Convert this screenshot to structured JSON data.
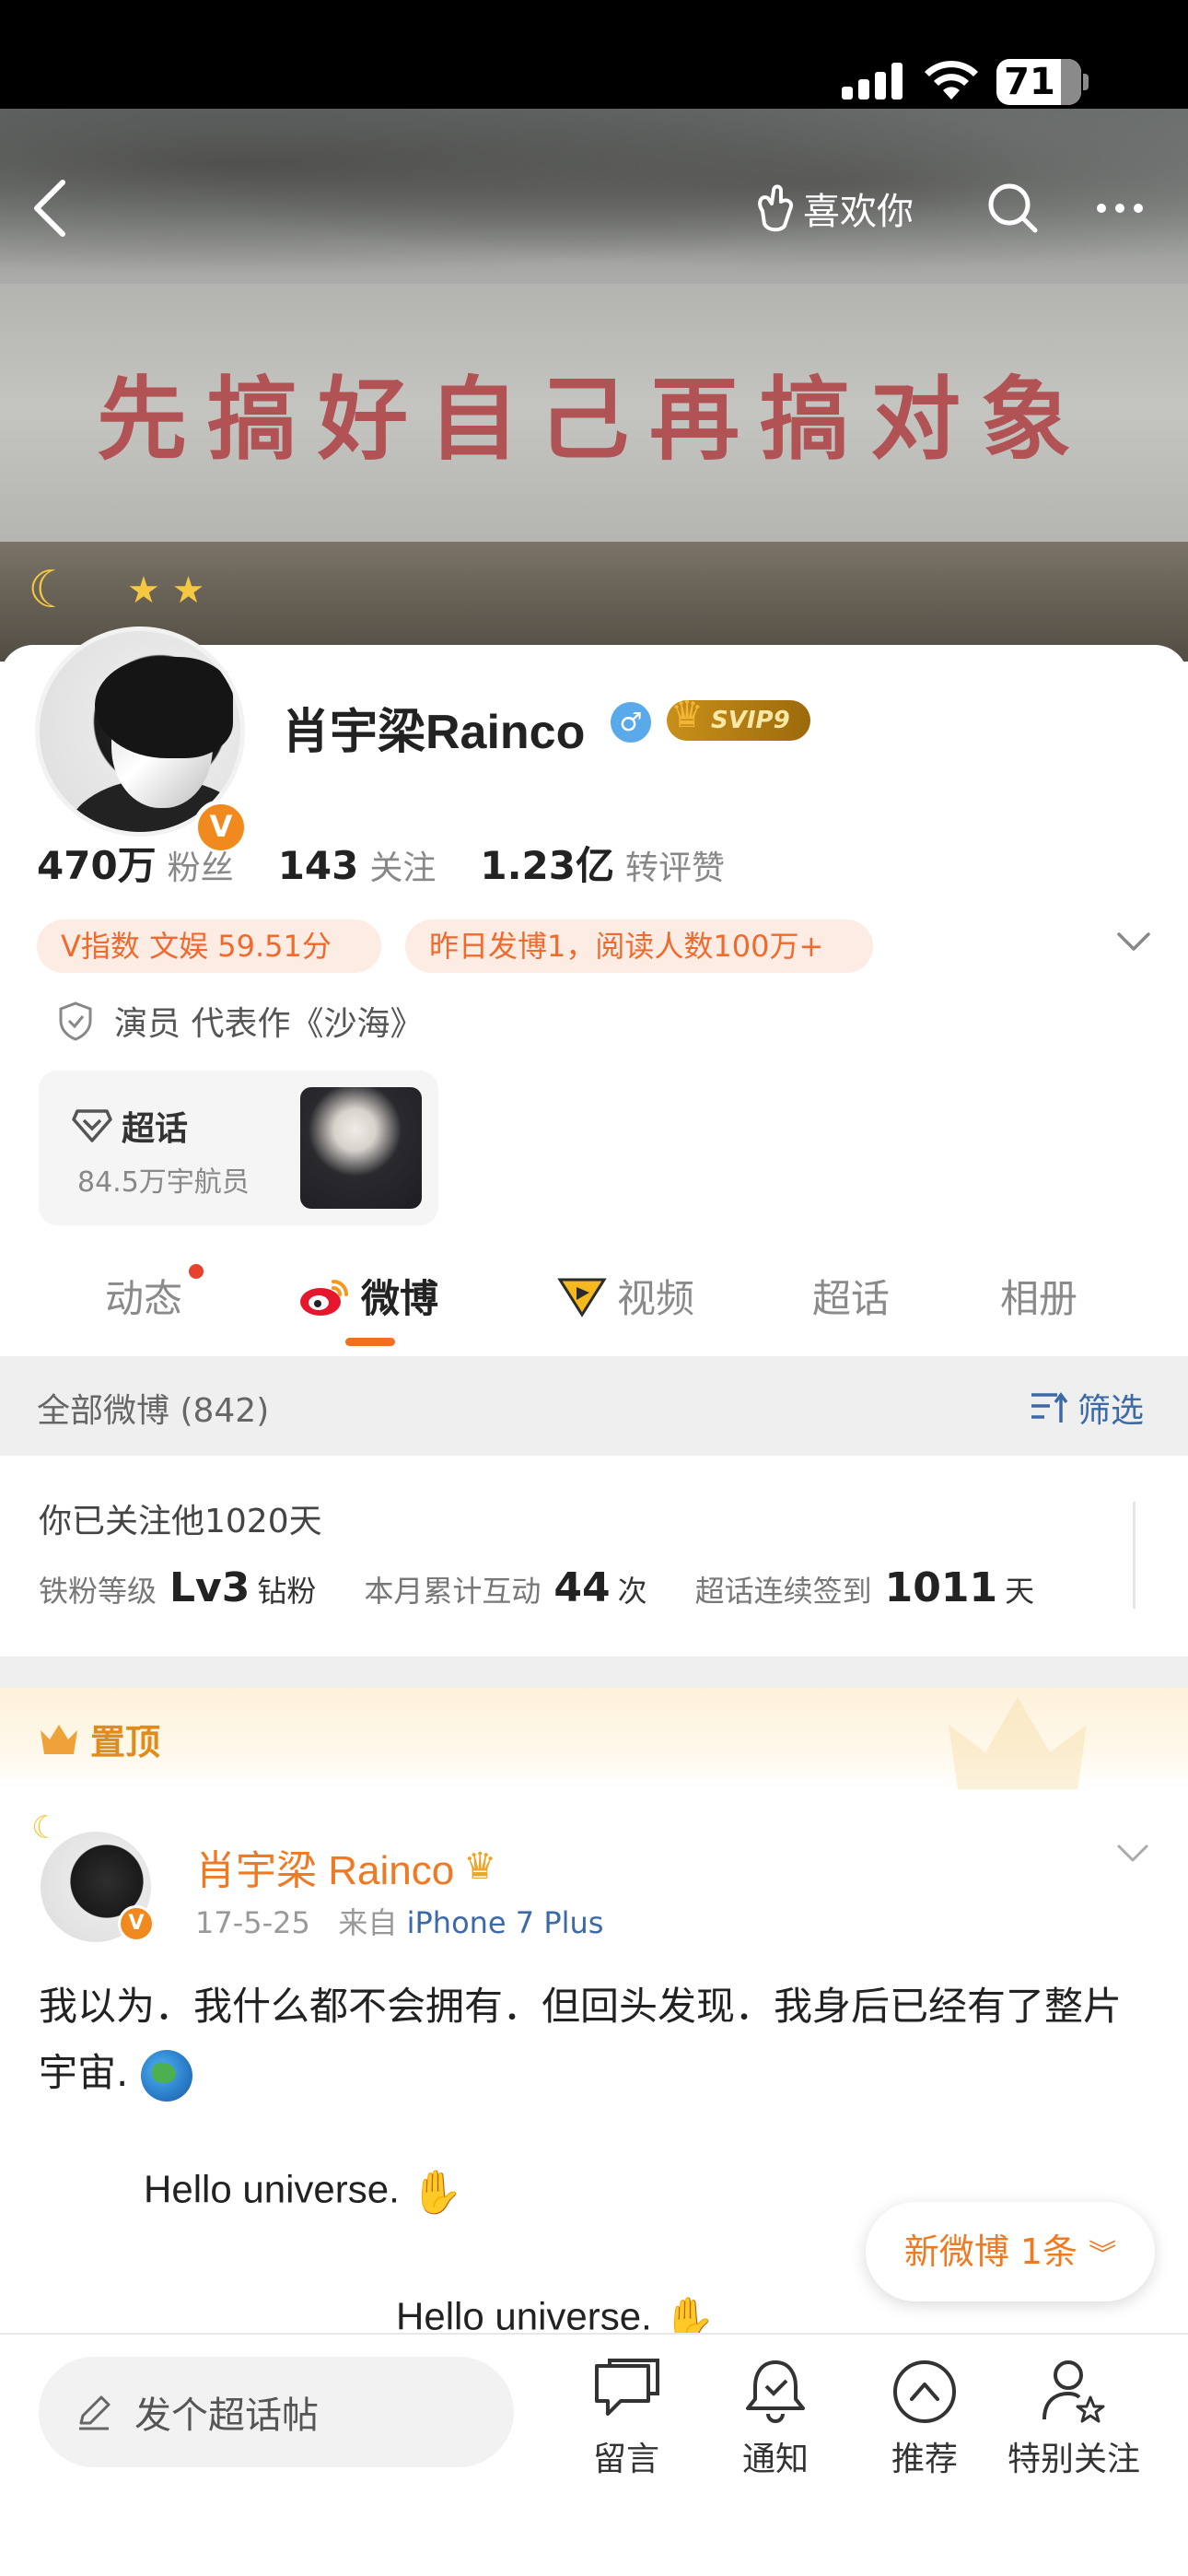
{
  "status": {
    "battery": "71"
  },
  "cover": {
    "slogan": "先搞好自己再搞对象"
  },
  "nav": {
    "like_you": "喜欢你"
  },
  "profile": {
    "name": "肖宇梁Rainco",
    "svip": "SVIP9",
    "verified_badge": "V",
    "stats": [
      {
        "num": "470万",
        "label": "粉丝"
      },
      {
        "num": "143",
        "label": "关注"
      },
      {
        "num": "1.23亿",
        "label": "转评赞"
      }
    ],
    "pill_v_index": "V指数 文娱 59.51分",
    "pill_yesterday": "昨日发博1，阅读人数100万+",
    "occupation": "演员 代表作《沙海》",
    "super_topic": {
      "title": "超话",
      "members": "84.5万宇航员"
    }
  },
  "tabs": [
    {
      "label": "动态"
    },
    {
      "label": "微博"
    },
    {
      "label": "视频"
    },
    {
      "label": "超话"
    },
    {
      "label": "相册"
    }
  ],
  "list_header": {
    "label": "全部微博 (842)",
    "filter": "筛选"
  },
  "fan_info": {
    "days": "你已关注他1020天",
    "level_label": "铁粉等级",
    "level_value": "Lv3",
    "level_unit": "钻粉",
    "monthly_label": "本月累计互动",
    "monthly_value": "44",
    "monthly_unit": "次",
    "checkin_label": "超话连续签到",
    "checkin_value": "1011",
    "checkin_unit": "天"
  },
  "pinned": {
    "label": "置顶"
  },
  "post": {
    "author": "肖宇梁 Rainco",
    "date": "17-5-25",
    "source_prefix": "来自",
    "source": "iPhone 7 Plus",
    "text": "我以为．我什么都不会拥有．但回头发现．我身后已经有了整片宇宙.",
    "hello1": "Hello universe.",
    "hello2": "Hello universe."
  },
  "new_weibo": "新微博 1条",
  "bottom": {
    "input_placeholder": "发个超话帖",
    "items": [
      {
        "label": "留言"
      },
      {
        "label": "通知"
      },
      {
        "label": "推荐"
      },
      {
        "label": "特别关注"
      }
    ]
  }
}
